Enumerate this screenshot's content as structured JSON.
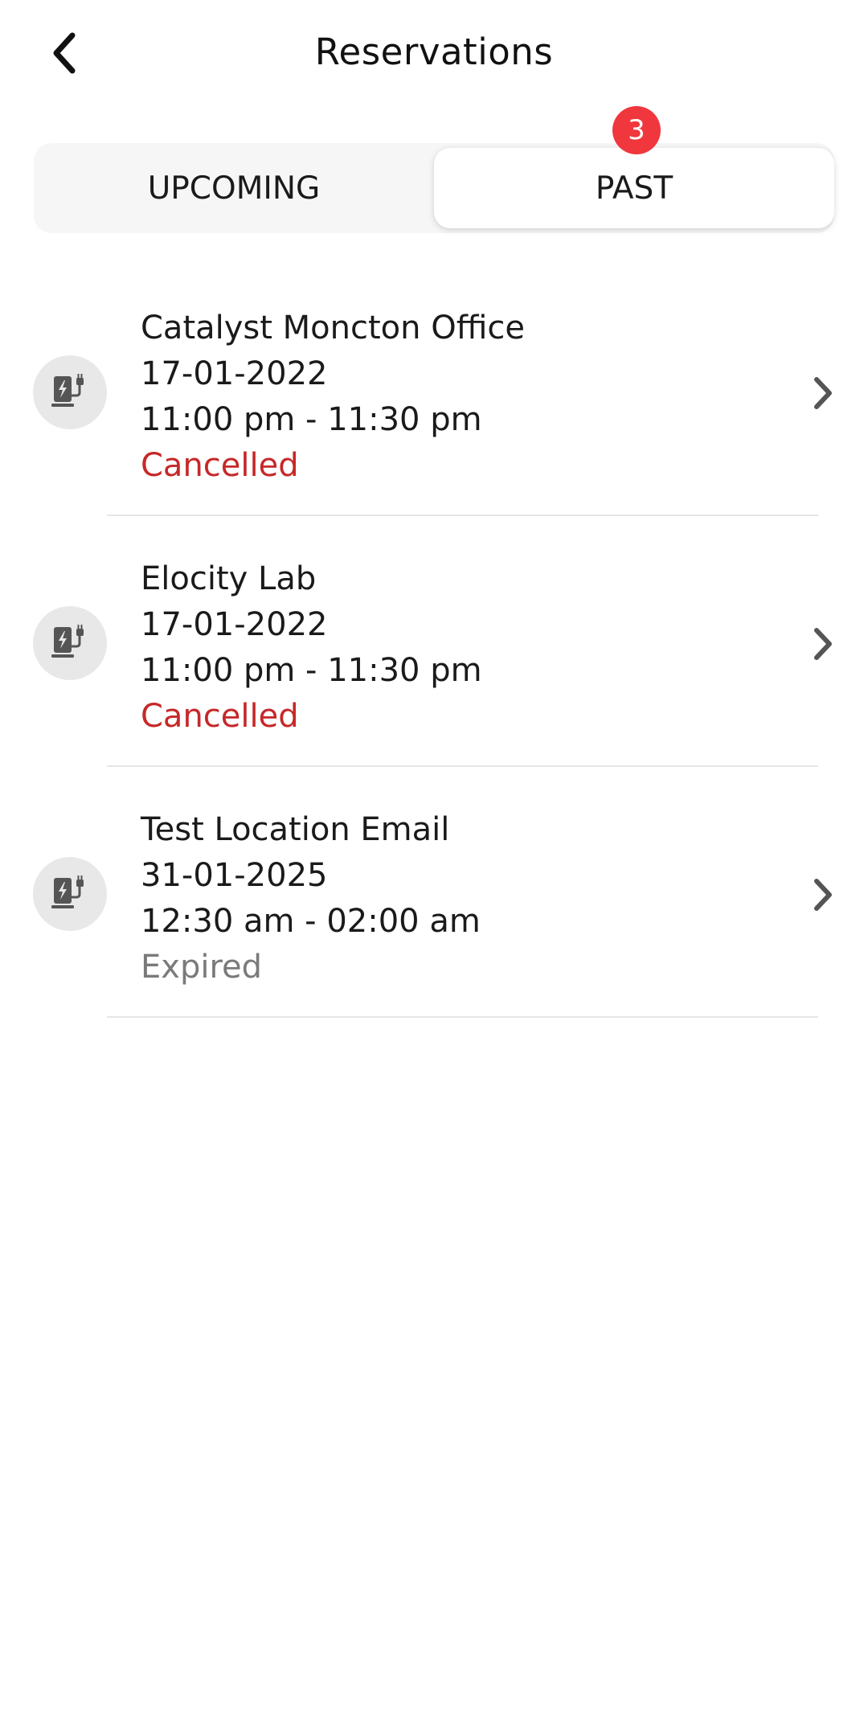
{
  "header": {
    "title": "Reservations",
    "back_icon": "chevron-left-icon"
  },
  "tabs": [
    {
      "label": "UPCOMING",
      "selected": false
    },
    {
      "label": "PAST",
      "selected": true
    }
  ],
  "badge": {
    "count": "3",
    "color": "#f0373e"
  },
  "reservations": [
    {
      "location": "Catalyst Moncton Office",
      "date": "17-01-2022",
      "time": "11:00 pm - 11:30 pm",
      "status": "Cancelled",
      "status_color": "#c62828",
      "icon": "ev-charger-icon"
    },
    {
      "location": "Elocity Lab",
      "date": "17-01-2022",
      "time": "11:00 pm - 11:30 pm",
      "status": "Cancelled",
      "status_color": "#c62828",
      "icon": "ev-charger-icon"
    },
    {
      "location": "Test Location Email",
      "date": "31-01-2025",
      "time": "12:30 am - 02:00 am",
      "status": "Expired",
      "status_color": "#7a7a7a",
      "icon": "ev-charger-icon"
    }
  ]
}
